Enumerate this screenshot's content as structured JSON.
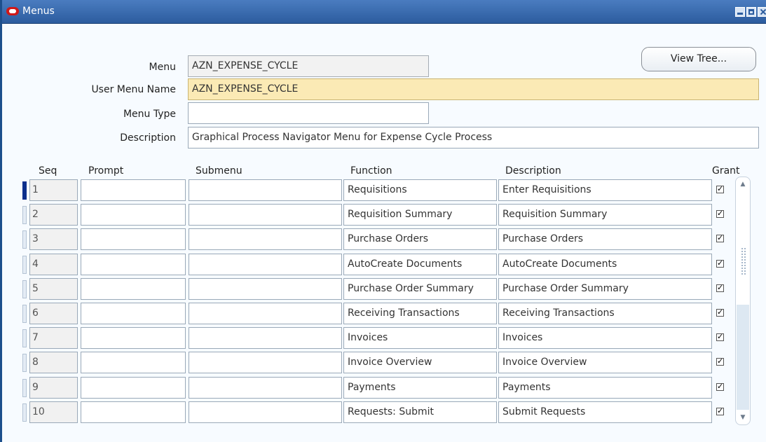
{
  "window": {
    "title": "Menus"
  },
  "form": {
    "menu_label": "Menu",
    "menu_value": "AZN_EXPENSE_CYCLE",
    "user_menu_name_label": "User Menu Name",
    "user_menu_name_value": "AZN_EXPENSE_CYCLE",
    "menu_type_label": "Menu Type",
    "menu_type_value": "",
    "description_label": "Description",
    "description_value": "Graphical Process Navigator Menu for Expense Cycle Process",
    "view_tree_label": "View Tree..."
  },
  "table": {
    "columns": {
      "seq": "Seq",
      "prompt": "Prompt",
      "submenu": "Submenu",
      "function": "Function",
      "description": "Description",
      "grant": "Grant"
    },
    "rows": [
      {
        "seq": "1",
        "prompt": "",
        "submenu": "",
        "function": "Requisitions",
        "description": "Enter Requisitions",
        "grant": true
      },
      {
        "seq": "2",
        "prompt": "",
        "submenu": "",
        "function": "Requisition Summary",
        "description": "Requisition Summary",
        "grant": true
      },
      {
        "seq": "3",
        "prompt": "",
        "submenu": "",
        "function": "Purchase Orders",
        "description": "Purchase Orders",
        "grant": true
      },
      {
        "seq": "4",
        "prompt": "",
        "submenu": "",
        "function": "AutoCreate Documents",
        "description": "AutoCreate Documents",
        "grant": true
      },
      {
        "seq": "5",
        "prompt": "",
        "submenu": "",
        "function": "Purchase Order Summary",
        "description": "Purchase Order Summary",
        "grant": true
      },
      {
        "seq": "6",
        "prompt": "",
        "submenu": "",
        "function": "Receiving Transactions",
        "description": "Receiving Transactions",
        "grant": true
      },
      {
        "seq": "7",
        "prompt": "",
        "submenu": "",
        "function": "Invoices",
        "description": "Invoices",
        "grant": true
      },
      {
        "seq": "8",
        "prompt": "",
        "submenu": "",
        "function": "Invoice Overview",
        "description": "Invoice Overview",
        "grant": true
      },
      {
        "seq": "9",
        "prompt": "",
        "submenu": "",
        "function": "Payments",
        "description": "Payments",
        "grant": true
      },
      {
        "seq": "10",
        "prompt": "",
        "submenu": "",
        "function": "Requests: Submit",
        "description": "Submit Requests",
        "grant": true
      }
    ]
  },
  "colors": {
    "titlebar": "#2c5c9e",
    "required_field": "#fbeab5",
    "current_record": "#0d2f8c"
  }
}
